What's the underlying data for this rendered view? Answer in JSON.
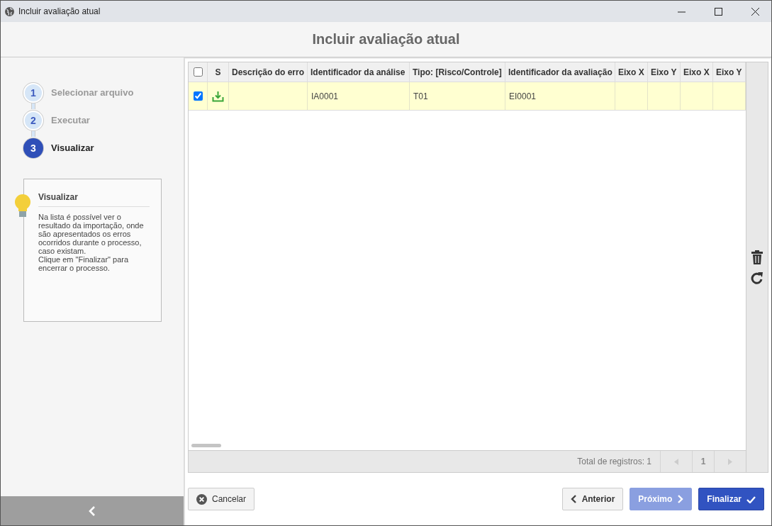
{
  "window": {
    "title": "Incluir avaliação atual"
  },
  "header": {
    "title": "Incluir avaliação atual"
  },
  "steps": [
    {
      "number": "1",
      "label": "Selecionar arquivo",
      "selected": false
    },
    {
      "number": "2",
      "label": "Executar",
      "selected": false
    },
    {
      "number": "3",
      "label": "Visualizar",
      "selected": true
    }
  ],
  "help": {
    "title": "Visualizar",
    "text": "Na lista é possível ver o resultado da importação, onde são apresentados os erros ocorridos durante o processo, caso existam.\nClique em \"Finalizar\" para encerrar o processo."
  },
  "table": {
    "select_all_checked": false,
    "columns": [
      "S",
      "Descrição do erro",
      "Identificador da análise",
      "Tipo: [Risco/Controle]",
      "Identificador da avaliação",
      "Eixo X",
      "Eixo Y",
      "Eixo X",
      "Eixo Y"
    ],
    "rows": [
      {
        "checked": true,
        "selected": true,
        "kind": "imported",
        "cells": [
          "",
          "",
          "IA0001",
          "T01",
          "EI0001",
          "",
          "",
          "",
          ""
        ]
      }
    ]
  },
  "footer": {
    "total": "Total de registros: 1",
    "page": "1"
  },
  "buttons": [
    {
      "kind": "cancel",
      "label": "Cancelar"
    },
    {
      "kind": "back",
      "label": "Anterior"
    },
    {
      "kind": "next",
      "label": "Próximo",
      "disabled": true
    },
    {
      "kind": "finish",
      "label": "Finalizar"
    }
  ]
}
